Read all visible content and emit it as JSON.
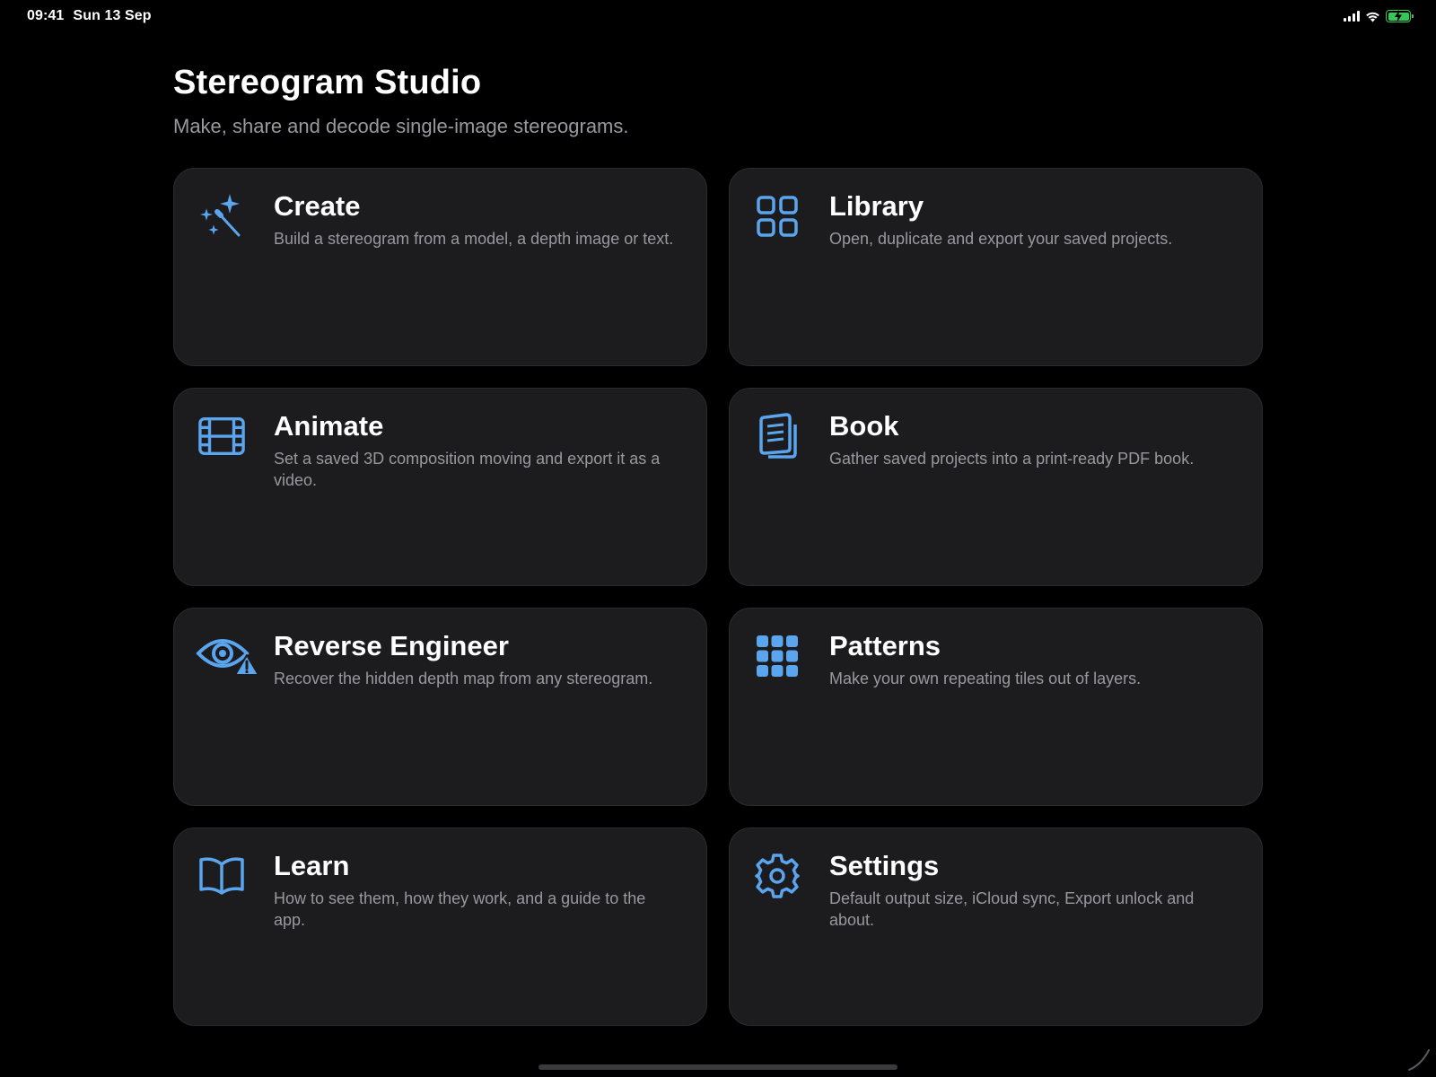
{
  "status_bar": {
    "time": "09:41",
    "date": "Sun 13 Sep",
    "icons": [
      "cellular-signal-icon",
      "wifi-icon",
      "battery-charging-icon"
    ]
  },
  "header": {
    "title": "Stereogram Studio",
    "subtitle": "Make, share and decode single-image stereograms."
  },
  "cards": [
    {
      "title": "Create",
      "description": "Build a stereogram from a model, a depth image or text.",
      "icon": "magic-wand-icon"
    },
    {
      "title": "Library",
      "description": "Open, duplicate and export your saved projects.",
      "icon": "grid-2x2-icon"
    },
    {
      "title": "Animate",
      "description": "Set a saved 3D composition moving and export it as a video.",
      "icon": "film-icon"
    },
    {
      "title": "Book",
      "description": "Gather saved projects into a print-ready PDF book.",
      "icon": "document-stack-icon"
    },
    {
      "title": "Reverse Engineer",
      "description": "Recover the hidden depth map from any stereogram.",
      "icon": "eye-warning-icon"
    },
    {
      "title": "Patterns",
      "description": "Make your own repeating tiles out of layers.",
      "icon": "grid-3x3-icon"
    },
    {
      "title": "Learn",
      "description": "How to see them, how they work, and a guide to the app.",
      "icon": "book-icon"
    },
    {
      "title": "Settings",
      "description": "Default output size, iCloud sync, Export unlock and about.",
      "icon": "gear-icon"
    }
  ],
  "colors": {
    "background": "#000000",
    "card": "#1c1c1e",
    "accent": "#5aa5ee",
    "secondary_text": "#98989f",
    "battery": "#35c759"
  }
}
